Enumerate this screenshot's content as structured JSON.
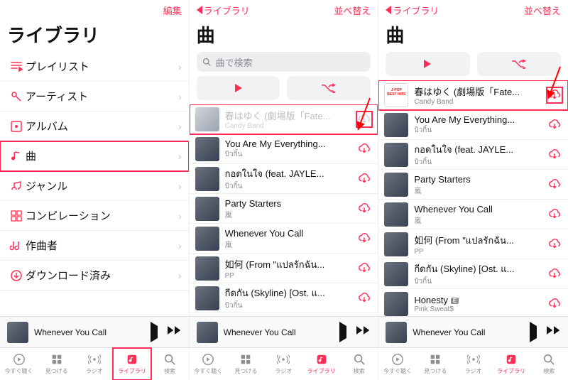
{
  "colors": {
    "accent": "#ff2d55"
  },
  "screen1": {
    "edit": "編集",
    "title": "ライブラリ",
    "rows": [
      {
        "icon": "playlist",
        "label": "プレイリスト"
      },
      {
        "icon": "mic",
        "label": "アーティスト"
      },
      {
        "icon": "album",
        "label": "アルバム"
      },
      {
        "icon": "note",
        "label": "曲",
        "highlight": true
      },
      {
        "icon": "genre",
        "label": "ジャンル"
      },
      {
        "icon": "comp",
        "label": "コンピレーション"
      },
      {
        "icon": "composer",
        "label": "作曲者"
      },
      {
        "icon": "download",
        "label": "ダウンロード済み"
      }
    ],
    "tab_highlight": true
  },
  "screen2": {
    "back": "ライブラリ",
    "sort": "並べ替え",
    "title": "曲",
    "search_placeholder": "曲で検索",
    "songs": [
      {
        "title": "春はゆく (劇場版「Fate...",
        "artist": "Candy Band",
        "dim": true,
        "art": "pale",
        "highlight_row": true,
        "highlight_dl": true
      },
      {
        "title": "You Are My Everything...",
        "artist": "บิวกิ้น"
      },
      {
        "title": "กอดในใจ (feat. JAYLE...",
        "artist": "บิวกิ้น"
      },
      {
        "title": "Party Starters",
        "artist": "嵐"
      },
      {
        "title": "Whenever You Call",
        "artist": "嵐"
      },
      {
        "title": "如何 (From \"แปลรักฉัน...",
        "artist": "PP"
      },
      {
        "title": "กีดกัน (Skyline) [Ost. แ...",
        "artist": "บิวกิ้น"
      }
    ],
    "arrow_to_first_dl": true
  },
  "screen3": {
    "back": "ライブラリ",
    "sort": "並べ替え",
    "title": "曲",
    "songs": [
      {
        "title": "春はゆく (劇場版「Fate...",
        "artist": "Candy Band",
        "art": "jp",
        "highlight_row": true,
        "highlight_dl": true
      },
      {
        "title": "You Are My Everything...",
        "artist": "บิวกิ้น"
      },
      {
        "title": "กอดในใจ (feat. JAYLE...",
        "artist": "บิวกิ้น"
      },
      {
        "title": "Party Starters",
        "artist": "嵐"
      },
      {
        "title": "Whenever You Call",
        "artist": "嵐"
      },
      {
        "title": "如何 (From \"แปลรักฉัน...",
        "artist": "PP"
      },
      {
        "title": "กีดกัน (Skyline) [Ost. แ...",
        "artist": "บิวกิ้น"
      },
      {
        "title": "Honesty",
        "artist": "Pink Sweat$",
        "explicit": true
      }
    ],
    "arrow_to_first_dl": true
  },
  "now_playing": {
    "title": "Whenever You Call"
  },
  "tabs": [
    {
      "id": "listen-now",
      "label": "今すぐ聴く"
    },
    {
      "id": "browse",
      "label": "見つける"
    },
    {
      "id": "radio",
      "label": "ラジオ"
    },
    {
      "id": "library",
      "label": "ライブラリ",
      "active": true
    },
    {
      "id": "search",
      "label": "検索"
    }
  ]
}
